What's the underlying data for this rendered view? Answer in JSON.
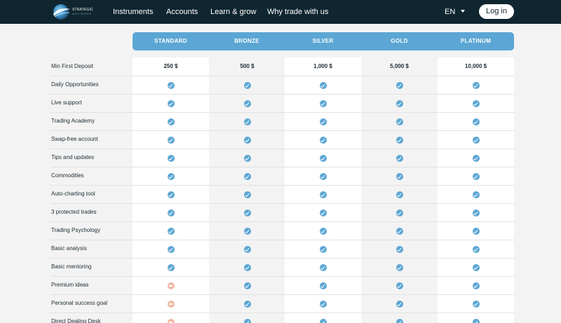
{
  "nav": {
    "brand": {
      "name": "STRATEGIC",
      "tagline": "ADVISORS"
    },
    "links": [
      {
        "label": "Instruments"
      },
      {
        "label": "Accounts"
      },
      {
        "label": "Learn & grow"
      },
      {
        "label": "Why trade with us"
      }
    ],
    "language": "EN",
    "login_label": "Log in"
  },
  "colors": {
    "nav_background": "#0f2630",
    "accent": "#5ba6d4",
    "unavailable": "#f2b7a4"
  },
  "table": {
    "tiers": [
      "STANDARD",
      "BRONZE",
      "SILVER",
      "GOLD",
      "PLATINUM"
    ],
    "deposit": {
      "label": "Min First Deposit",
      "values": [
        "250 $",
        "500 $",
        "1,000 $",
        "5,000 $",
        "10,000 $"
      ]
    },
    "features": [
      {
        "label": "Daily Opportunities",
        "included": [
          true,
          true,
          true,
          true,
          true
        ]
      },
      {
        "label": "Live support",
        "included": [
          true,
          true,
          true,
          true,
          true
        ]
      },
      {
        "label": "Trading Academy",
        "included": [
          true,
          true,
          true,
          true,
          true
        ]
      },
      {
        "label": "Swap-free account",
        "included": [
          true,
          true,
          true,
          true,
          true
        ]
      },
      {
        "label": "Tips and updates",
        "included": [
          true,
          true,
          true,
          true,
          true
        ]
      },
      {
        "label": "Commodities",
        "included": [
          true,
          true,
          true,
          true,
          true
        ]
      },
      {
        "label": "Auto-charting tool",
        "included": [
          true,
          true,
          true,
          true,
          true
        ]
      },
      {
        "label": "3 protected trades",
        "included": [
          true,
          true,
          true,
          true,
          true
        ]
      },
      {
        "label": "Trading Psychology",
        "included": [
          true,
          true,
          true,
          true,
          true
        ]
      },
      {
        "label": "Basic analysis",
        "included": [
          true,
          true,
          true,
          true,
          true
        ]
      },
      {
        "label": "Basic mentoring",
        "included": [
          true,
          true,
          true,
          true,
          true
        ]
      },
      {
        "label": "Premium ideas",
        "included": [
          false,
          true,
          true,
          true,
          true
        ]
      },
      {
        "label": "Personal success goal",
        "included": [
          false,
          true,
          true,
          true,
          true
        ]
      },
      {
        "label": "Direct Dealing Desk",
        "included": [
          false,
          true,
          true,
          true,
          true
        ]
      }
    ]
  }
}
